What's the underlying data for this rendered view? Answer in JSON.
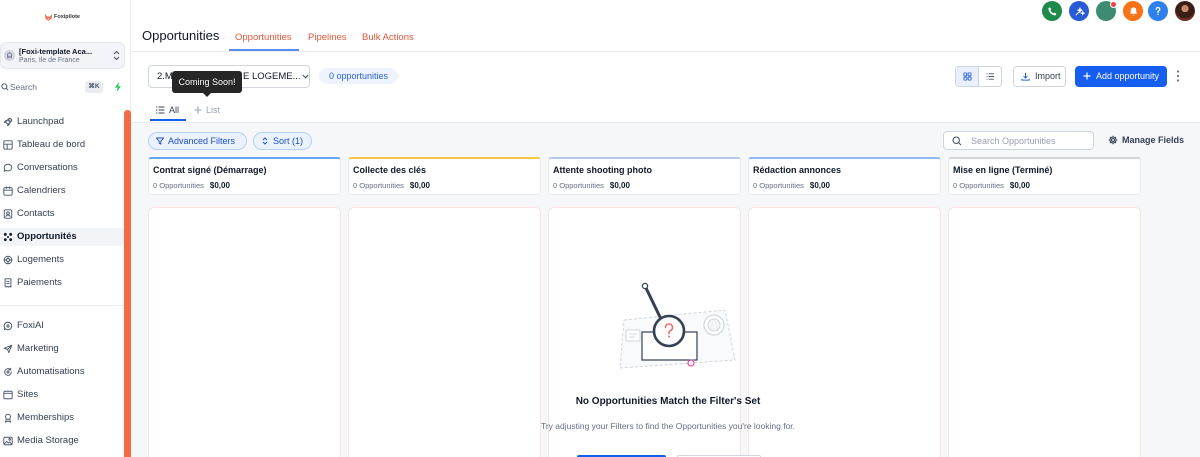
{
  "brand": {
    "logo_text": "Foxipilote",
    "logo_icon": "fox-logo-icon"
  },
  "sidebar": {
    "account": {
      "name": "[Foxi-template Aca...",
      "location": "Paris, Ile de France",
      "icon": "building-icon"
    },
    "search": {
      "label": "Search",
      "shortcut": "⌘K"
    },
    "nav_primary": [
      {
        "label": "Launchpad",
        "icon": "rocket-icon"
      },
      {
        "label": "Tableau de bord",
        "icon": "dashboard-icon"
      },
      {
        "label": "Conversations",
        "icon": "chat-icon"
      },
      {
        "label": "Calendriers",
        "icon": "calendar-icon"
      },
      {
        "label": "Contacts",
        "icon": "contacts-icon"
      },
      {
        "label": "Opportunités",
        "icon": "opportunities-icon",
        "active": true
      },
      {
        "label": "Logements",
        "icon": "housing-icon"
      },
      {
        "label": "Paiements",
        "icon": "receipt-icon"
      }
    ],
    "nav_secondary": [
      {
        "label": "FoxiAI",
        "icon": "ai-icon"
      },
      {
        "label": "Marketing",
        "icon": "send-icon"
      },
      {
        "label": "Automatisations",
        "icon": "automation-icon"
      },
      {
        "label": "Sites",
        "icon": "browser-icon"
      },
      {
        "label": "Memberships",
        "icon": "membership-icon"
      },
      {
        "label": "Media Storage",
        "icon": "image-icon"
      }
    ]
  },
  "topbar": {
    "icons": [
      "phone-icon",
      "quick-action-icon",
      "account-avatar",
      "notifications-bell-icon",
      "help-icon",
      "user-avatar"
    ],
    "notification_dot": true
  },
  "header": {
    "title": "Opportunities",
    "tabs": [
      {
        "label": "Opportunities",
        "active": true
      },
      {
        "label": "Pipelines",
        "active": false
      },
      {
        "label": "Bulk Actions",
        "active": false
      }
    ]
  },
  "toolbar": {
    "pipeline_select": {
      "visible_text_start": "2.M",
      "visible_text_end": "E LOGEME..."
    },
    "tooltip": "Coming Soon!",
    "count_badge": "0 opportunities",
    "view_mode": "board",
    "import_label": "Import",
    "add_label": "Add opportunity"
  },
  "views": {
    "tabs": [
      {
        "label": "All",
        "active": true
      },
      {
        "label": "List",
        "active": false
      }
    ]
  },
  "filters": {
    "advanced_label": "Advanced Filters",
    "sort_label": "Sort (1)",
    "search_placeholder": "Search Opportunities",
    "manage_fields_label": "Manage Fields"
  },
  "columns": [
    {
      "title": "Contrat signé (Démarrage)",
      "count": "0 Opportunities",
      "amount": "$0,00",
      "color": "#6aa6f8"
    },
    {
      "title": "Collecte des clés",
      "count": "0 Opportunities",
      "amount": "$0,00",
      "color": "#f5c84c"
    },
    {
      "title": "Attente shooting photo",
      "count": "0 Opportunities",
      "amount": "$0,00",
      "color": "#b9c8e6"
    },
    {
      "title": "Rédaction annonces",
      "count": "0 Opportunities",
      "amount": "$0,00",
      "color": "#8fb8f5"
    },
    {
      "title": "Mise en ligne (Terminé)",
      "count": "0 Opportunities",
      "amount": "$0,00",
      "color": "#d0d5dd"
    }
  ],
  "empty_state": {
    "title": "No Opportunities Match the Filter's Set",
    "message": "Try adjusting your Filters to find the Opportunities you're looking for."
  },
  "colors": {
    "primary": "#155eef",
    "tab_text": "#e0573a",
    "scrollbar": "#f26b47",
    "phone": "#1e8a4c",
    "quick_action": "#2a5bd7",
    "avatar": "#3d8b73",
    "bell": "#f97316",
    "help": "#2f80ed"
  }
}
